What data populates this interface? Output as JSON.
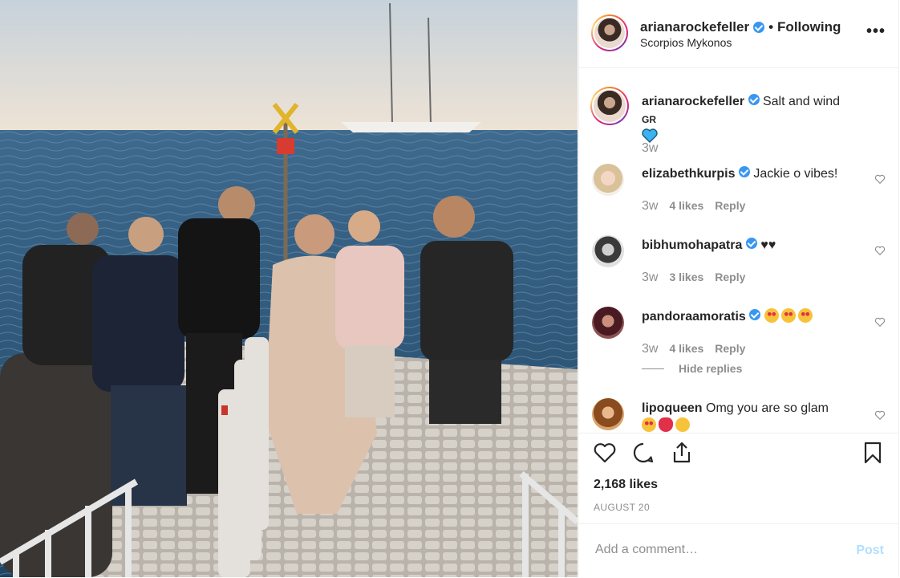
{
  "post": {
    "author": "arianarockefeller",
    "follow_label": "Following",
    "location": "Scorpios Mykonos",
    "more_glyph": "•••"
  },
  "caption": {
    "username": "arianarockefeller",
    "text": "Salt and wind",
    "flag_text": "GR",
    "emoji": "blue-heart",
    "time": "3w"
  },
  "comments": [
    {
      "username": "elizabethkurpis",
      "text": "Jackie o vibes!",
      "time": "3w",
      "likes": "4 likes",
      "reply": "Reply",
      "verified": true
    },
    {
      "username": "bibhumohapatra",
      "text": "♥♥",
      "time": "3w",
      "likes": "3 likes",
      "reply": "Reply",
      "verified": true
    },
    {
      "username": "pandoraamoratis",
      "text": "",
      "emoji": [
        "heart-eyes",
        "heart-eyes",
        "heart-eyes"
      ],
      "time": "3w",
      "likes": "4 likes",
      "reply": "Reply",
      "verified": true
    },
    {
      "username": "lipoqueen",
      "text": "Omg you are so glam",
      "emoji": [
        "heart-eyes",
        "hearts",
        "grin"
      ],
      "verified": false
    }
  ],
  "replies_toggle": "Hide replies",
  "likes_count": "2,168 likes",
  "date": "AUGUST 20",
  "comment_input": {
    "placeholder": "Add a comment…",
    "post_label": "Post"
  },
  "colors": {
    "verified": "#3897f0",
    "post_disabled": "#b2dffc",
    "meta": "#8e8e8e"
  },
  "icons": [
    "heart-icon",
    "comment-icon",
    "share-icon",
    "bookmark-icon",
    "verified-icon",
    "more-icon"
  ]
}
